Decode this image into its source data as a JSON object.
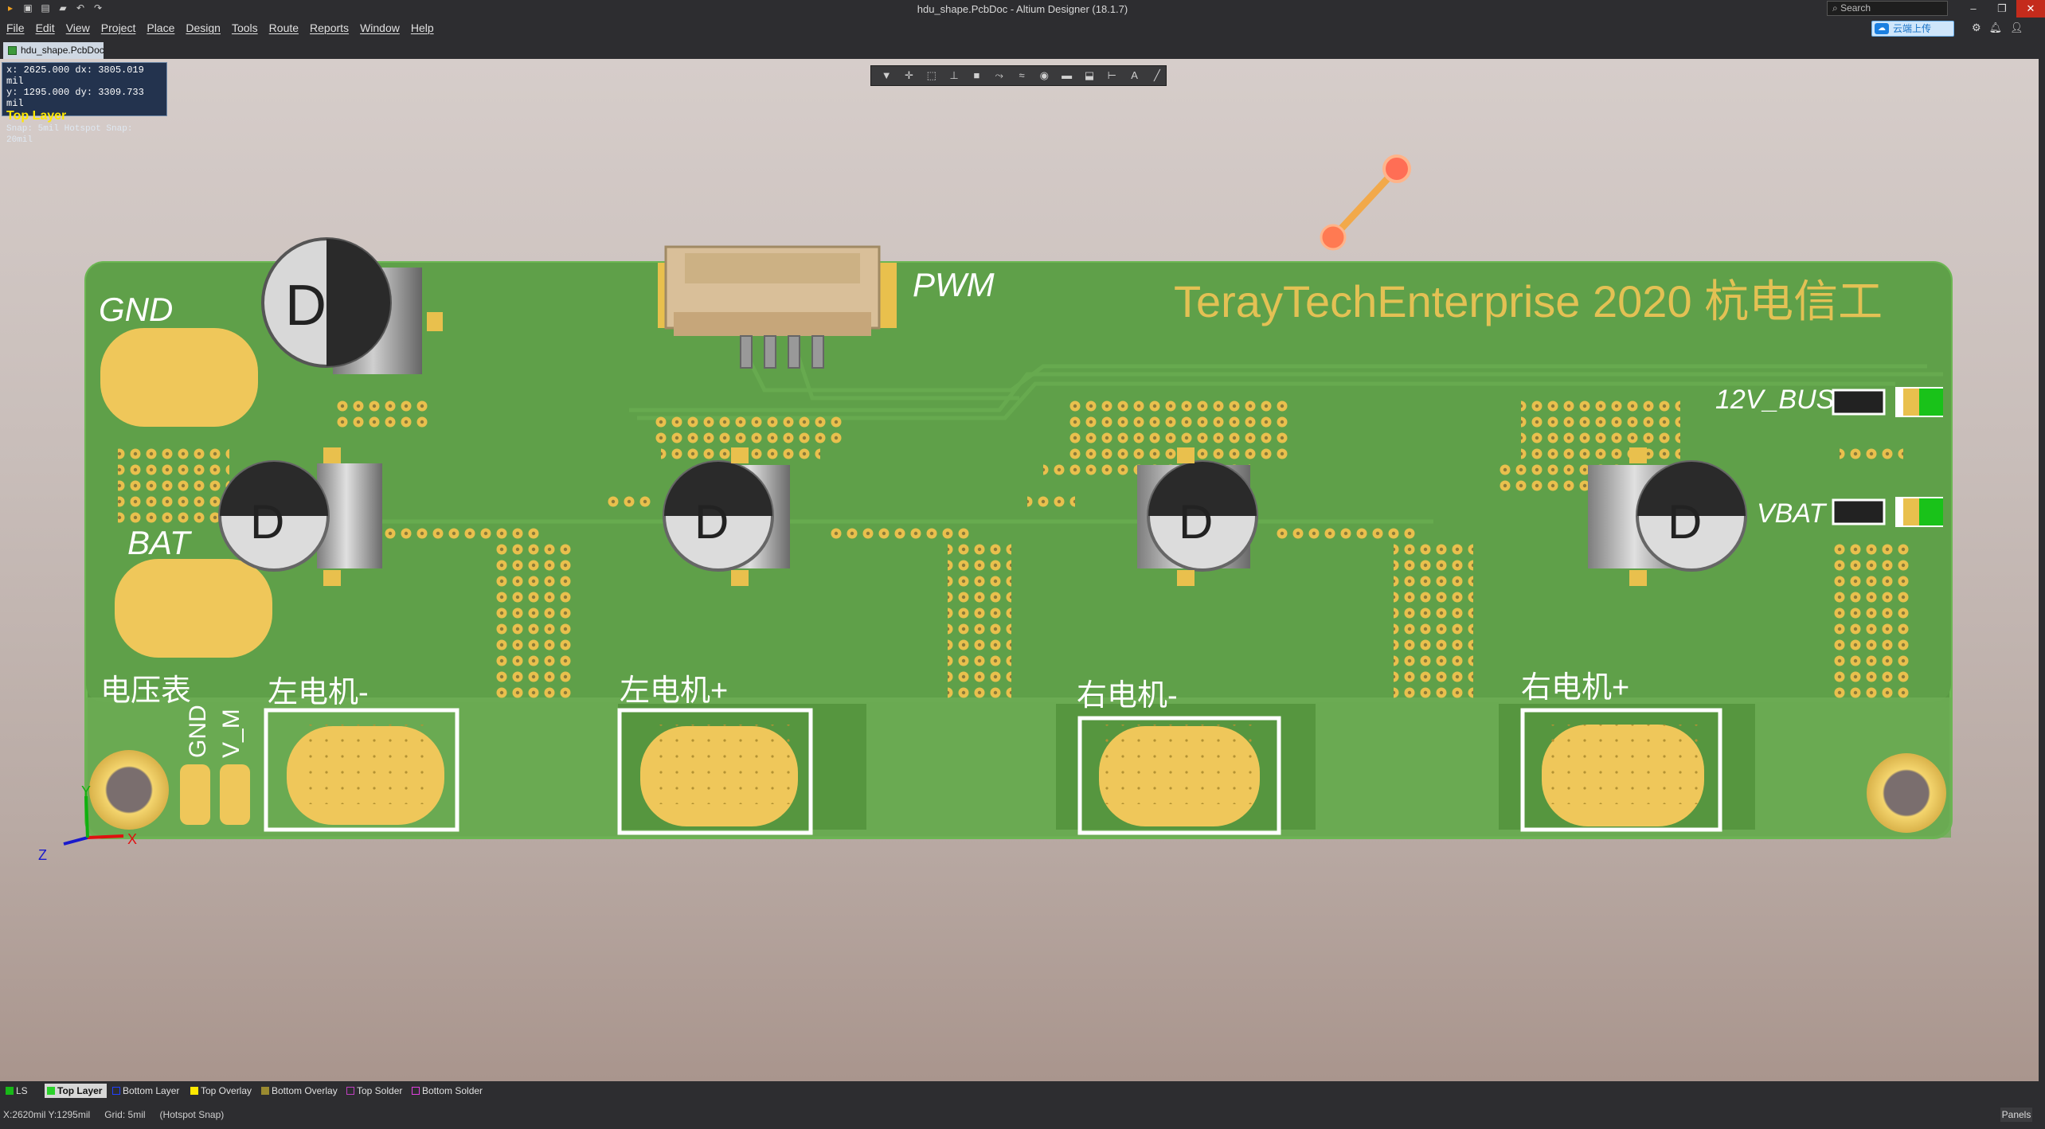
{
  "window": {
    "title": "hdu_shape.PcbDoc - Altium Designer (18.1.7)",
    "search_placeholder": "Search",
    "cloud_button": "云端上传"
  },
  "menu": [
    "File",
    "Edit",
    "View",
    "Project",
    "Place",
    "Design",
    "Tools",
    "Route",
    "Reports",
    "Window",
    "Help"
  ],
  "document_tab": "hdu_shape.PcbDoc",
  "hud": {
    "line1": "x: 2625.000   dx:  3805.019 mil",
    "line2": "y: 1295.000   dy:  3309.733 mil",
    "layer": "Top Layer",
    "snap": "Snap: 5mil Hotspot Snap: 20mil"
  },
  "board": {
    "colors": {
      "board": "#5fa049",
      "pad": "#e9c04d",
      "silk": "#ffffff",
      "text": "#e8c75a",
      "copper_dark": "#4f8a3a"
    },
    "silkscreen": {
      "gnd": "GND",
      "bat": "BAT",
      "pwm": "PWM",
      "bus12v": "12V_BUS",
      "vbat": "VBAT",
      "brand": "TerayTechEnterprise   2020 杭电信工",
      "voltmeter": "电压表",
      "gnd_vertical": "GND",
      "vm_vertical": "V_M",
      "left_motor_minus": "左电机-",
      "left_motor_plus": "左电机+",
      "right_motor_minus": "右电机-",
      "right_motor_plus": "右电机+",
      "cap_mark": "D"
    },
    "axes": {
      "x": "X",
      "y": "Y",
      "z": "Z"
    }
  },
  "layer_tabs": [
    {
      "label": "LS",
      "color": "#18b818"
    },
    {
      "label": "Top Layer",
      "color": "#2bd12b"
    },
    {
      "label": "Bottom Layer",
      "color": "#2040ff"
    },
    {
      "label": "Top Overlay",
      "color": "#ffe800"
    },
    {
      "label": "Bottom Overlay",
      "color": "#9a8a30"
    },
    {
      "label": "Top Solder",
      "color": "#c040c0"
    },
    {
      "label": "Bottom Solder",
      "color": "#e040e0"
    }
  ],
  "status": {
    "coords": "X:2620mil Y:1295mil",
    "grid": "Grid: 5mil",
    "snap": "(Hotspot Snap)",
    "panels": "Panels"
  }
}
